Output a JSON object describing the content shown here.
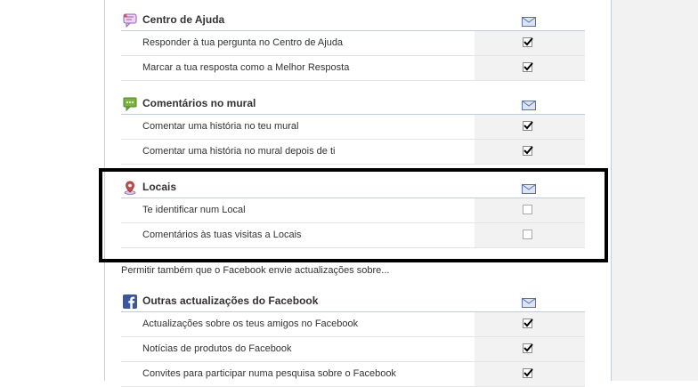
{
  "sections": {
    "centro_ajuda": {
      "title": "Centro de Ajuda",
      "rows": [
        {
          "label": "Responder à tua pergunta no Centro de Ajuda",
          "checked": true
        },
        {
          "label": "Marcar a tua resposta como a Melhor Resposta",
          "checked": true
        }
      ]
    },
    "comentarios_mural": {
      "title": "Comentários no mural",
      "rows": [
        {
          "label": "Comentar uma história no teu mural",
          "checked": true
        },
        {
          "label": "Comentar uma história no mural depois de ti",
          "checked": true
        }
      ]
    },
    "locais": {
      "title": "Locais",
      "rows": [
        {
          "label": "Te identificar num Local",
          "checked": false
        },
        {
          "label": "Comentários às tuas visitas a Locais",
          "checked": false
        }
      ]
    },
    "outras_facebook": {
      "title": "Outras actualizações do Facebook",
      "rows": [
        {
          "label": "Actualizações sobre os teus amigos no Facebook",
          "checked": true
        },
        {
          "label": "Notícias de produtos do Facebook",
          "checked": true
        },
        {
          "label": "Convites para participar numa pesquisa sobre o Facebook",
          "checked": true
        }
      ]
    }
  },
  "notice_text": "Permitir também que o Facebook envie actualizações sobre...",
  "icons": {
    "centro_ajuda": "help-center-icon",
    "comentarios_mural": "wall-comment-icon",
    "locais": "places-pin-icon",
    "outras_facebook": "facebook-logo-icon",
    "email": "envelope-icon"
  },
  "colors": {
    "accent_blue": "#3b5998",
    "checkbox_column": "#f2f2f2",
    "highlight_border": "#000000"
  }
}
